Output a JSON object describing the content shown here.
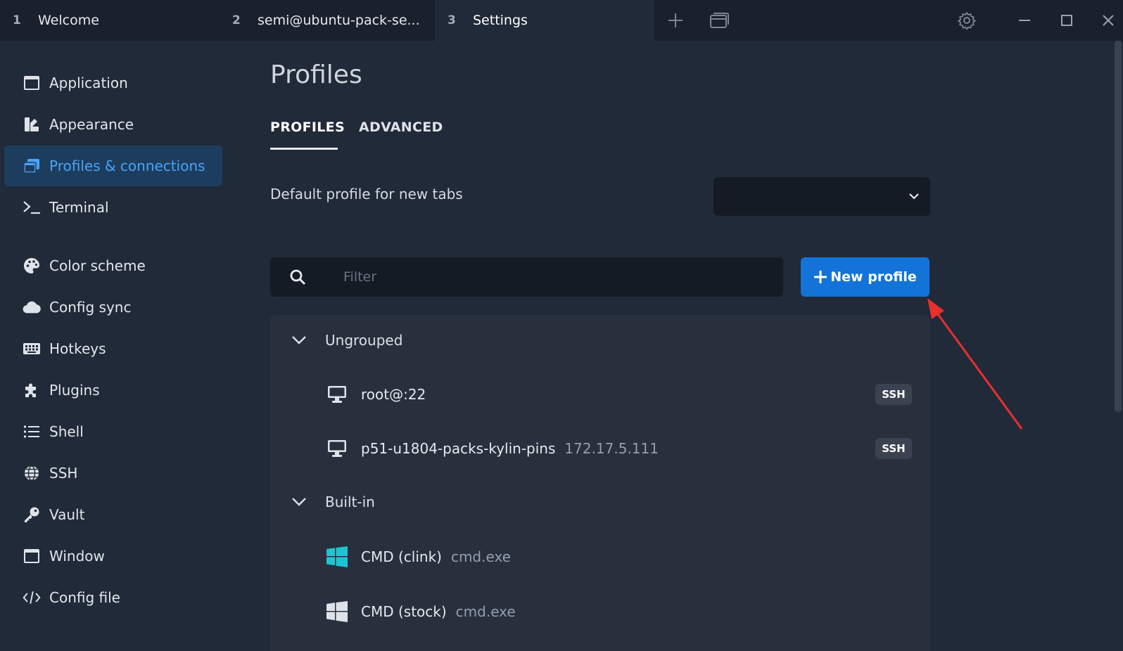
{
  "tabs": [
    {
      "num": "1",
      "label": "Welcome"
    },
    {
      "num": "2",
      "label": "semi@ubuntu-pack-se..."
    },
    {
      "num": "3",
      "label": "Settings"
    }
  ],
  "sidebar": {
    "items": [
      {
        "label": "Application"
      },
      {
        "label": "Appearance"
      },
      {
        "label": "Profiles & connections"
      },
      {
        "label": "Terminal"
      },
      {
        "label": "Color scheme"
      },
      {
        "label": "Config sync"
      },
      {
        "label": "Hotkeys"
      },
      {
        "label": "Plugins"
      },
      {
        "label": "Shell"
      },
      {
        "label": "SSH"
      },
      {
        "label": "Vault"
      },
      {
        "label": "Window"
      },
      {
        "label": "Config file"
      }
    ]
  },
  "main": {
    "title": "Profiles",
    "subtabs": [
      "PROFILES",
      "ADVANCED"
    ],
    "default_profile_label": "Default profile for new tabs",
    "default_profile_value": "",
    "filter_placeholder": "Filter",
    "new_profile_label": "New profile",
    "groups": [
      {
        "name": "Ungrouped",
        "profiles": [
          {
            "name": "root@:22",
            "desc": "",
            "badge": "SSH",
            "icon": "monitor-icon"
          },
          {
            "name": "p51-u1804-packs-kylin-pins",
            "desc": "172.17.5.111",
            "badge": "SSH",
            "icon": "monitor-icon"
          }
        ]
      },
      {
        "name": "Built-in",
        "profiles": [
          {
            "name": "CMD (clink)",
            "desc": "cmd.exe",
            "badge": "",
            "icon": "windows-logo-icon"
          },
          {
            "name": "CMD (stock)",
            "desc": "cmd.exe",
            "badge": "",
            "icon": "windows-logo-icon"
          }
        ]
      }
    ]
  },
  "colors": {
    "background": "#212a38",
    "titlebar": "#1a212d",
    "accent": "#1373d8",
    "sidebar_active_bg": "#1d3d5f",
    "sidebar_active_text": "#4aa3f5",
    "annotation_arrow": "#e8302f",
    "clink_icon": "#1fc4d3"
  }
}
